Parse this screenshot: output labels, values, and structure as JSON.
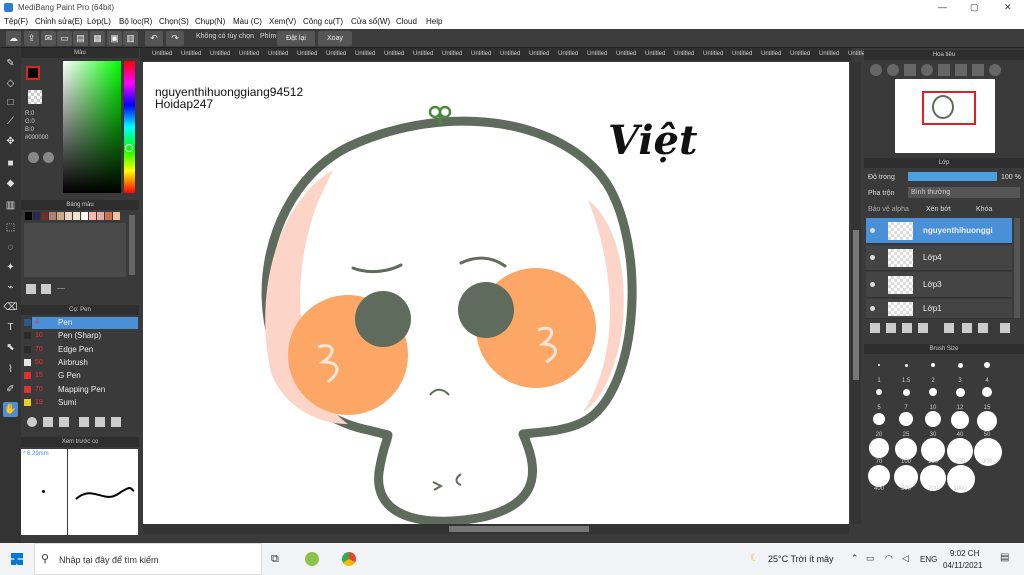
{
  "window": {
    "title": "MediBang Paint Pro (64bit)",
    "minimize": "—",
    "maximize": "▢",
    "close": "✕"
  },
  "menu": [
    "Tệp(F)",
    "Chỉnh sửa(E)",
    "Lớp(L)",
    "Bộ lọc(R)",
    "Chọn(S)",
    "Chụp(N)",
    "Màu (C)",
    "Xem(V)",
    "Công cụ(T)",
    "Cửa sổ(W)",
    "Cloud",
    "Help"
  ],
  "toolbar": {
    "correction": "Không có tùy chọn",
    "hotkey": "Phím",
    "reset": "Đặt lại",
    "rotate": "Xoay"
  },
  "tabs": [
    "Untitled",
    "Untitled",
    "Untitled",
    "Untitled",
    "Untitled",
    "Untitled",
    "Untitled",
    "Untitled",
    "Untitled",
    "Untitled",
    "Untitled",
    "Untitled",
    "Untitled",
    "Untitled",
    "Untitled",
    "Untitled",
    "Untitled",
    "Untitled",
    "Untitled",
    "Untitled",
    "Untitled",
    "Untitled",
    "Untitled",
    "Untitled",
    "Untitled",
    "Untitled",
    "Untitled",
    "Untitled",
    "Untitled",
    "Untitled"
  ],
  "color_panel": {
    "title": "Màu",
    "r": "R:0",
    "g": "G:0",
    "b": "B:0",
    "hex": "#000000",
    "primary": "#000000",
    "accent": "#dd2222"
  },
  "palette_panel": {
    "title": "Bảng màu",
    "swatches": [
      "#000000",
      "#2a2a4a",
      "#6d2e2e",
      "#b08070",
      "#c9a98a",
      "#e8d2c0",
      "#f0e4d0",
      "#ffffff",
      "#f4b8b0",
      "#e8a8a8",
      "#c87050",
      "#f0c0a0"
    ],
    "footer": "----"
  },
  "brush_panel": {
    "title": "Cọ: Pen",
    "items": [
      {
        "size": "4",
        "name": "Pen",
        "color": "#2b5a8a"
      },
      {
        "size": "10",
        "name": "Pen (Sharp)",
        "color": "#2a2a2a"
      },
      {
        "size": "70",
        "name": "Edge Pen",
        "color": "#2a2a2a"
      },
      {
        "size": "50",
        "name": "Airbrush",
        "color": "#e8e8e8"
      },
      {
        "size": "15",
        "name": "G Pen",
        "color": "#dd3333"
      },
      {
        "size": "70",
        "name": "Mapping Pen",
        "color": "#dd3333"
      },
      {
        "size": "19",
        "name": "Sumi",
        "color": "#e8d020"
      }
    ]
  },
  "preview_panel": {
    "title": "Xem trước cọ",
    "size": "* 6.29mm"
  },
  "canvas": {
    "watermark_user": "nguyenthihuonggiang94512",
    "watermark_site": "Hoidap247",
    "signature": "Việt"
  },
  "navigator": {
    "title": "Hoa tiêu"
  },
  "layers": {
    "title": "Lớp",
    "opacity_label": "Độ trong",
    "opacity_value": "100 %",
    "blend_label": "Pha trộn",
    "blend_value": "Bình thường",
    "protect_alpha": "Bảo vệ alpha",
    "clipping": "Xén bớt",
    "lock": "Khóa",
    "items": [
      "nguyenthihuonggi",
      "Lớp4",
      "Lớp3",
      "Lớp1"
    ]
  },
  "brush_size": {
    "title": "Brush Size",
    "sizes": [
      "1",
      "1.5",
      "2",
      "3",
      "4",
      "5",
      "7",
      "10",
      "12",
      "15",
      "20",
      "25",
      "30",
      "40",
      "50",
      "70",
      "100",
      "150",
      "200",
      "300",
      "400",
      "500",
      "700",
      "1000"
    ]
  },
  "taskbar": {
    "search_placeholder": "Nhập tại đây để tìm kiếm",
    "weather": "25°C  Trời ít mây",
    "lang": "ENG",
    "time": "9:02 CH",
    "date": "04/11/2021"
  }
}
